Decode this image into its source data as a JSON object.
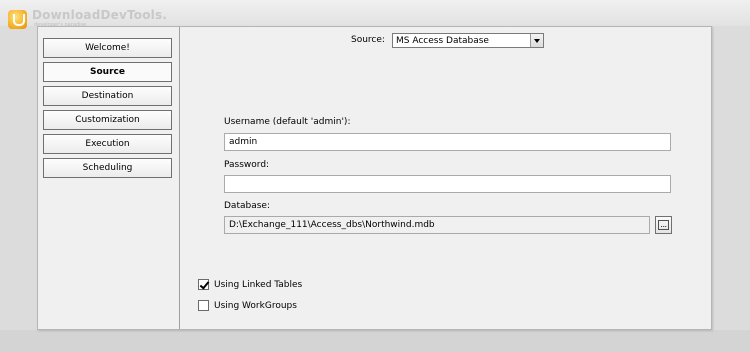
{
  "watermark": {
    "title": "DownloadDevTools.",
    "subtitle": "developer's paradise"
  },
  "nav": {
    "items": [
      {
        "label": "Welcome!",
        "active": false
      },
      {
        "label": "Source",
        "active": true
      },
      {
        "label": "Destination",
        "active": false
      },
      {
        "label": "Customization",
        "active": false
      },
      {
        "label": "Execution",
        "active": false
      },
      {
        "label": "Scheduling",
        "active": false
      }
    ]
  },
  "source": {
    "label": "Source:",
    "selected": "MS Access Database"
  },
  "username": {
    "label": "Username (default 'admin'):",
    "value": "admin"
  },
  "password": {
    "label": "Password:",
    "value": ""
  },
  "database": {
    "label": "Database:",
    "value": "D:\\Exchange_111\\Access_dbs\\Northwind.mdb",
    "browse_label": "..."
  },
  "options": {
    "linked_tables": {
      "label": "Using Linked Tables",
      "checked": true
    },
    "workgroups": {
      "label": "Using WorkGroups",
      "checked": false
    }
  }
}
